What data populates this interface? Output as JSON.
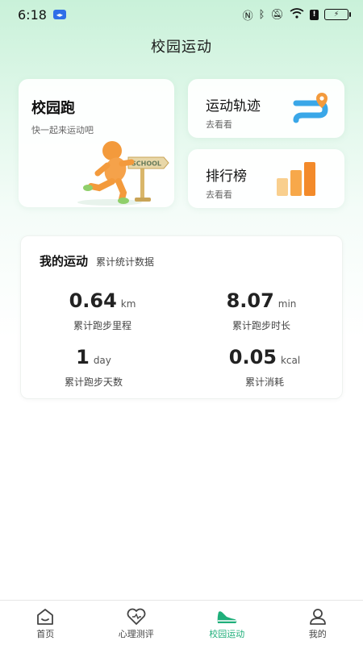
{
  "status_bar": {
    "time": "6:18",
    "battery_text": "⚡"
  },
  "header": {
    "title": "校园运动"
  },
  "cards": {
    "run": {
      "title": "校园跑",
      "subtitle": "快一起来运动吧",
      "sign_text": "SCHOOL"
    },
    "track": {
      "title": "运动轨迹",
      "subtitle": "去看看"
    },
    "rank": {
      "title": "排行榜",
      "subtitle": "去看看"
    }
  },
  "stats": {
    "title": "我的运动",
    "subtitle": "累计统计数据",
    "items": [
      {
        "value": "0.64",
        "unit": "km",
        "label": "累计跑步里程"
      },
      {
        "value": "8.07",
        "unit": "min",
        "label": "累计跑步时长"
      },
      {
        "value": "1",
        "unit": "day",
        "label": "累计跑步天数"
      },
      {
        "value": "0.05",
        "unit": "kcal",
        "label": "累计消耗"
      }
    ]
  },
  "tabbar": {
    "items": [
      {
        "label": "首页",
        "icon": "home-icon"
      },
      {
        "label": "心理测评",
        "icon": "heart-icon"
      },
      {
        "label": "校园运动",
        "icon": "shoe-icon",
        "active": true
      },
      {
        "label": "我的",
        "icon": "profile-icon"
      }
    ]
  },
  "colors": {
    "accent": "#1faf7a",
    "orange": "#f39a3c",
    "blue": "#3aa7e8"
  }
}
